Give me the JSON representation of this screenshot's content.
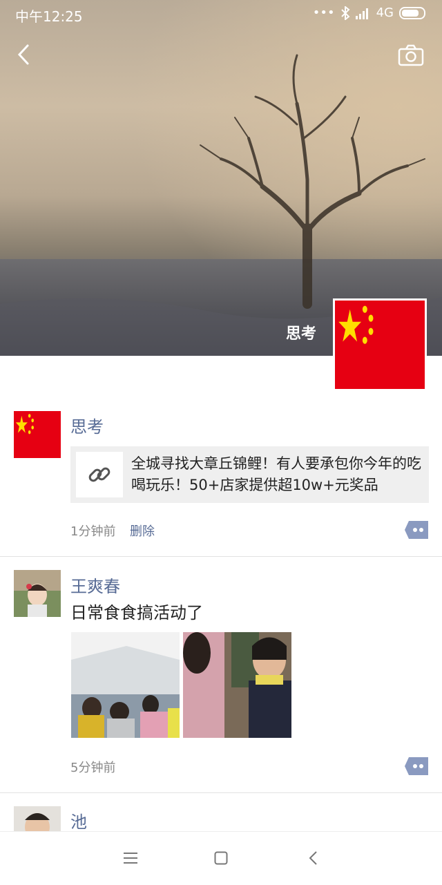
{
  "status_bar": {
    "time": "中午12:25",
    "network": "4G",
    "dots": "•••"
  },
  "profile": {
    "cover_name": "思考"
  },
  "posts": [
    {
      "author": "思考",
      "link_title": "全城寻找大章丘锦鲤！有人要承包你今年的吃喝玩乐！50+店家提供超10w+元奖品",
      "time": "1分钟前",
      "delete_label": "删除"
    },
    {
      "author": "王爽春",
      "text": "日常食食搞活动了",
      "time": "5分钟前"
    },
    {
      "author": "池"
    }
  ],
  "icons": [
    "back-icon",
    "camera-icon",
    "link-icon",
    "more-icon",
    "menu-icon",
    "home-icon",
    "back-nav-icon",
    "bluetooth-icon",
    "signal-icon",
    "battery-icon"
  ],
  "colors": {
    "name_link": "#576b95",
    "flag_red": "#e60012",
    "flag_star": "#ffde00"
  }
}
